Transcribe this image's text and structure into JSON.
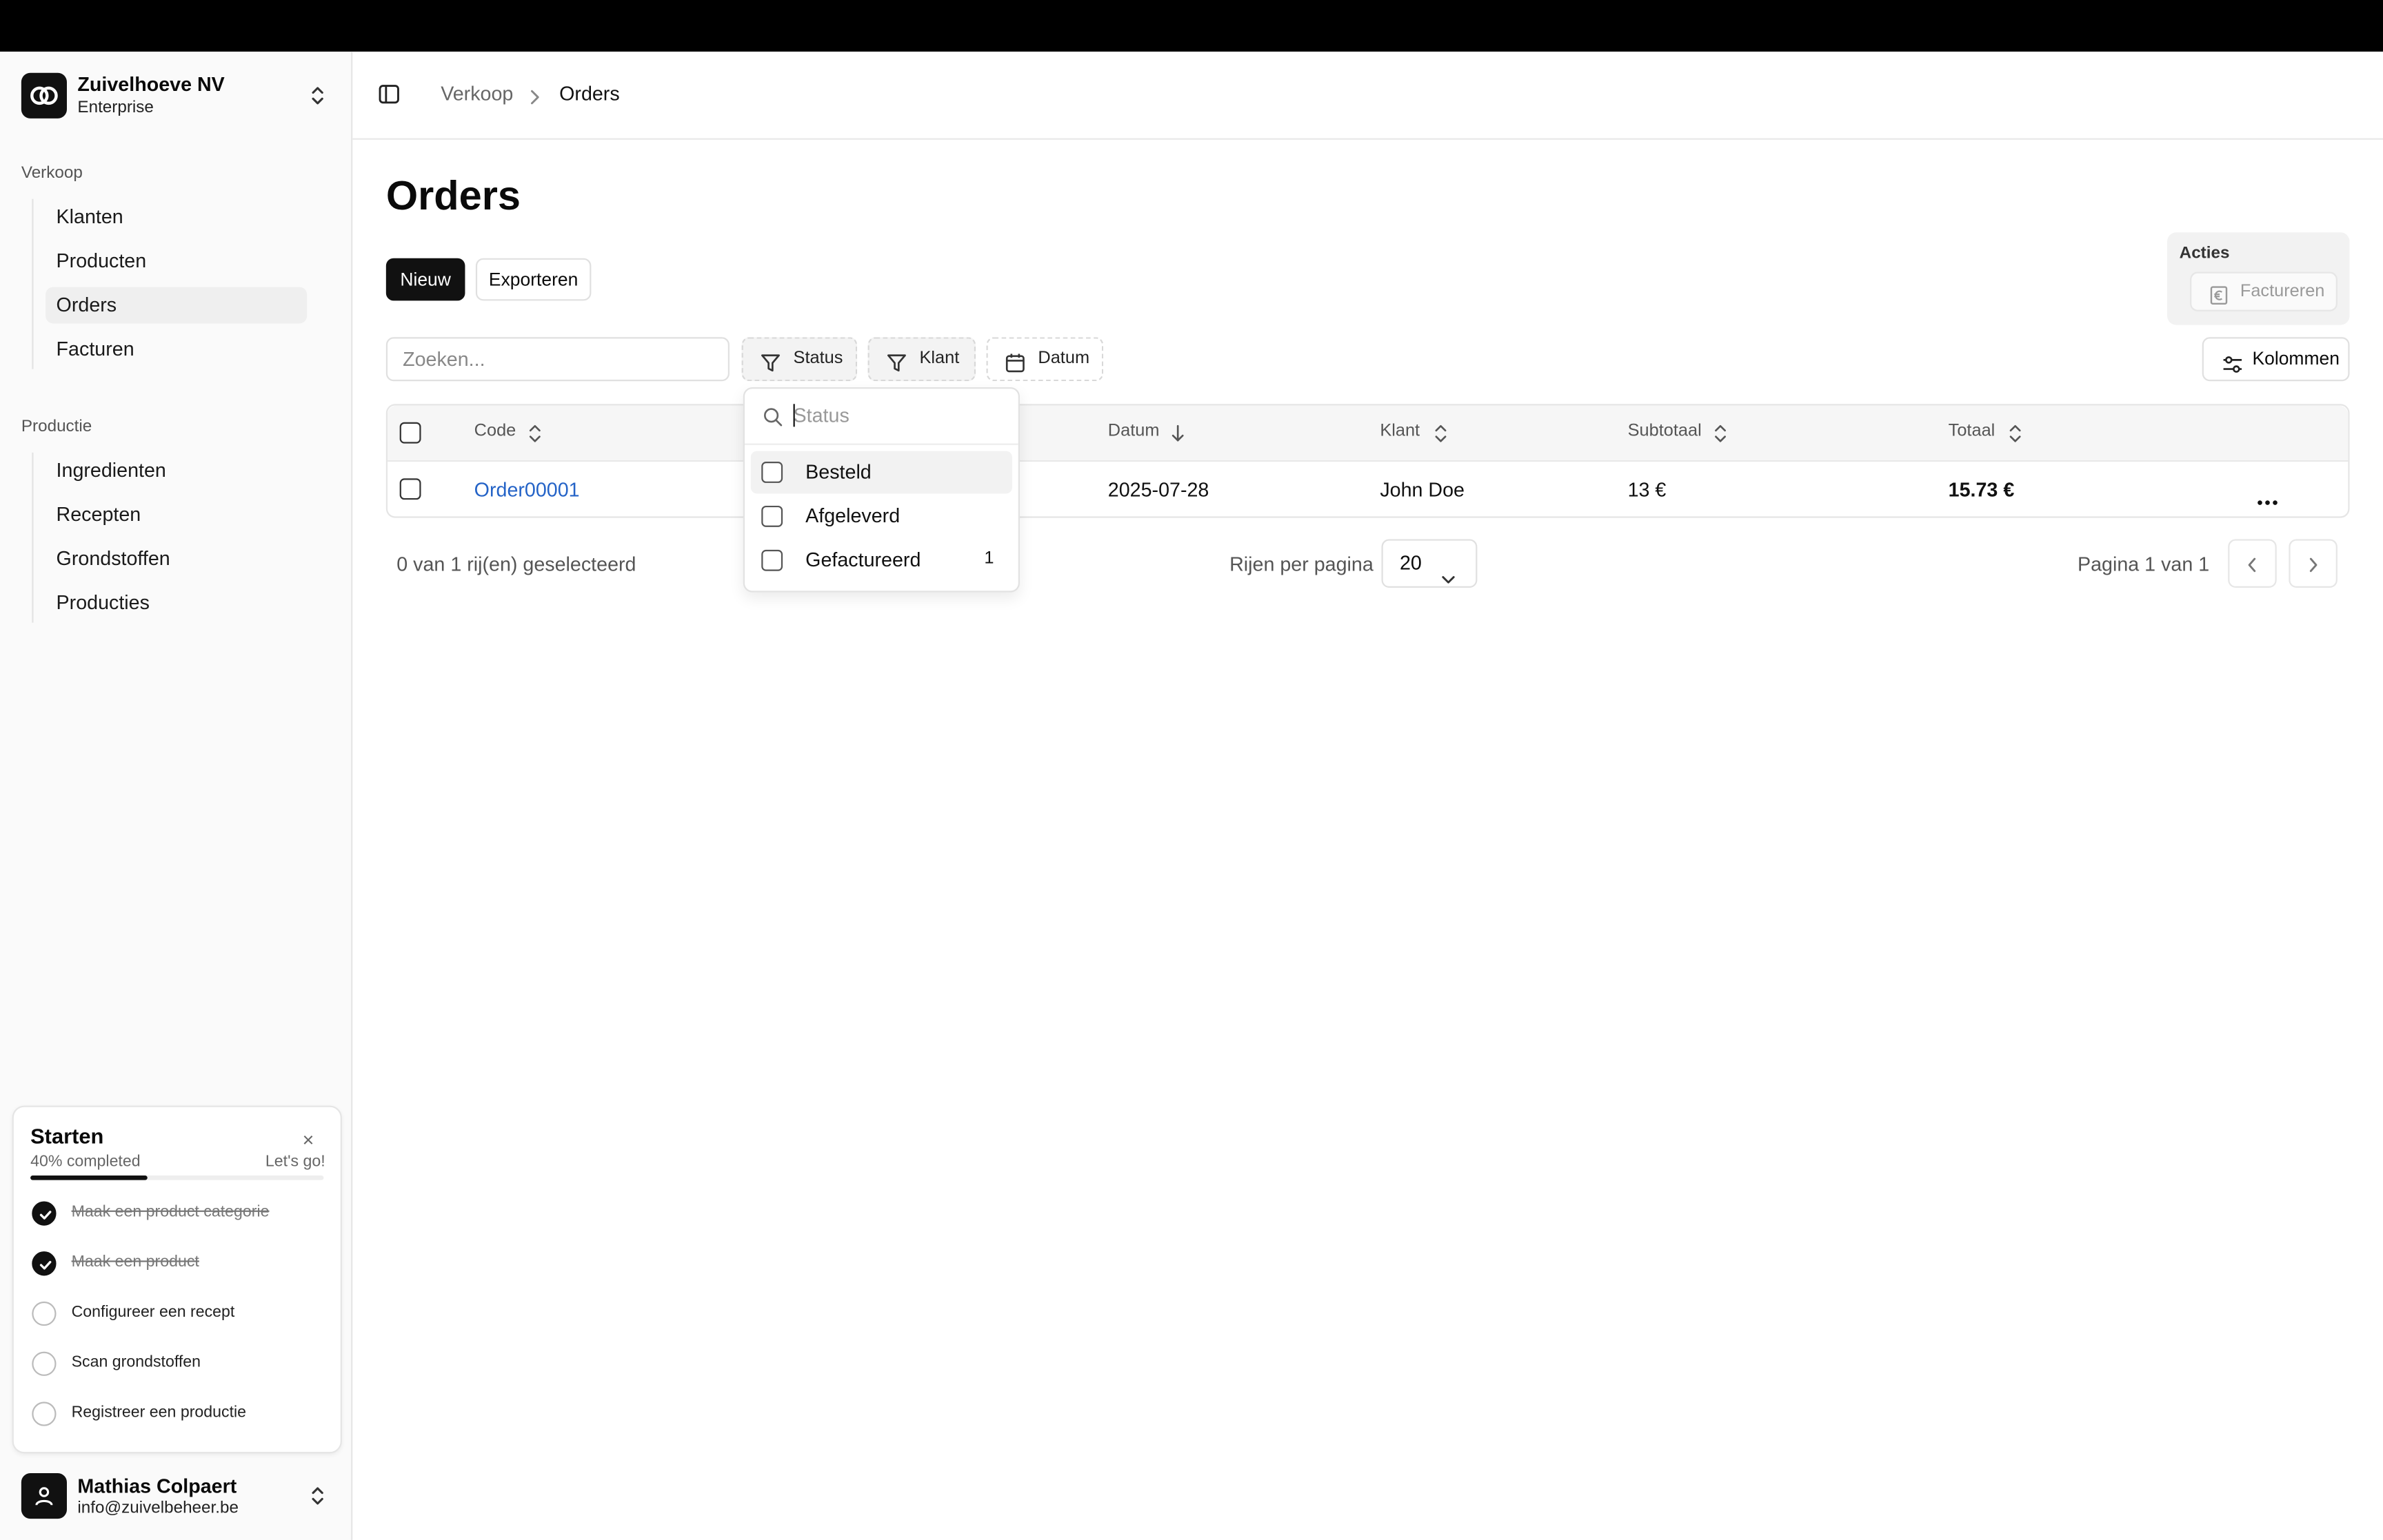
{
  "org": {
    "name": "Zuivelhoeve NV",
    "plan": "Enterprise"
  },
  "sidebar": {
    "sections": [
      {
        "label": "Verkoop",
        "items": [
          {
            "label": "Klanten"
          },
          {
            "label": "Producten"
          },
          {
            "label": "Orders",
            "active": true
          },
          {
            "label": "Facturen"
          }
        ]
      },
      {
        "label": "Productie",
        "items": [
          {
            "label": "Ingredienten"
          },
          {
            "label": "Recepten"
          },
          {
            "label": "Grondstoffen"
          },
          {
            "label": "Producties"
          }
        ]
      }
    ]
  },
  "onboarding": {
    "title": "Starten",
    "close": "×",
    "progress_text": "40% completed",
    "progress_value": 0.4,
    "cta": "Let's go!",
    "tasks": [
      {
        "label": "Maak een product categorie",
        "done": true
      },
      {
        "label": "Maak een product",
        "done": true
      },
      {
        "label": "Configureer een recept",
        "done": false
      },
      {
        "label": "Scan grondstoffen",
        "done": false
      },
      {
        "label": "Registreer een productie",
        "done": false
      }
    ]
  },
  "user": {
    "name": "Mathias Colpaert",
    "email": "info@zuivelbeheer.be"
  },
  "breadcrumb": {
    "parent": "Verkoop",
    "current": "Orders"
  },
  "page": {
    "title": "Orders"
  },
  "toolbar": {
    "new_label": "Nieuw",
    "export_label": "Exporteren"
  },
  "actions": {
    "label": "Acties",
    "invoice_label": "Factureren"
  },
  "filters": {
    "search_placeholder": "Zoeken...",
    "status": "Status",
    "klant": "Klant",
    "datum": "Datum",
    "columns": "Kolommen"
  },
  "table": {
    "headers": {
      "code": "Code",
      "datum": "Datum",
      "klant": "Klant",
      "subtotaal": "Subtotaal",
      "totaal": "Totaal"
    },
    "rows": [
      {
        "code": "Order00001",
        "datum": "2025-07-28",
        "klant": "John Doe",
        "subtotaal": "13 €",
        "totaal": "15.73 €"
      }
    ]
  },
  "footer": {
    "selection": "0 van 1 rij(en) geselecteerd",
    "rows_per_page_label": "Rijen per pagina",
    "rows_per_page": "20",
    "page_info": "Pagina 1 van 1"
  },
  "status_dropdown": {
    "placeholder": "Status",
    "options": [
      {
        "label": "Besteld",
        "count": ""
      },
      {
        "label": "Afgeleverd",
        "count": ""
      },
      {
        "label": "Gefactureerd",
        "count": "1"
      }
    ]
  }
}
